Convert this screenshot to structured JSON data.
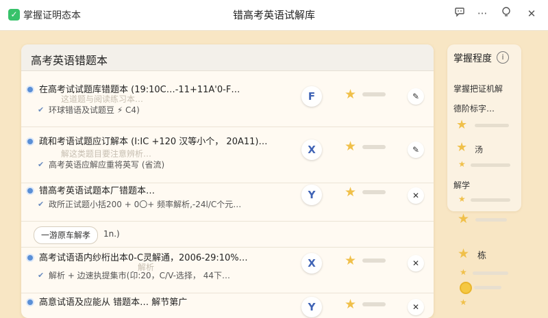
{
  "window": {
    "app_name": "掌握证明态本",
    "title": "错高考英语试解库",
    "buttons": [
      "chat-icon",
      "more-icon",
      "bulb-icon",
      "close-icon"
    ]
  },
  "panel": {
    "title": "高考英语错题本",
    "items": [
      {
        "title": "在高考试试题库错题本 (19:10C…-11+11A'0-F…",
        "ghost": "这道题与阅读练习本…",
        "subtitle": "环球错语及试题豆 ⚡ C4)",
        "action_icon": "pencil-icon"
      },
      {
        "title": "疏和考语试题应订解本 (I:IC +120 汉等小个， 20A11)…",
        "ghost": "解这类题目要注意辨析…",
        "subtitle": "高考英语应解应重将英写 (省流)",
        "action_icon": "pencil-icon"
      },
      {
        "title": "错高考英语试题本厂错题本…",
        "ghost": "",
        "subtitle": "政所正试题小括200 + 0〇+ 频率解析,-24l/C个元…",
        "action_icon": "close-icon"
      }
    ],
    "group": {
      "label": "一游原车解孝",
      "count": "1n.)"
    },
    "items2": [
      {
        "title": "高考试语语内纱桁出本0-C灵解通，2006-29:10%…",
        "ghost": "解析",
        "subtitle": "解析 + 边速执提集市(卬:20，C/V-选择， 44下…",
        "action_icon": "close-icon"
      },
      {
        "title": "高意试语及应能从 错题本… 解节第广",
        "ghost": "",
        "subtitle": "",
        "action_icon": "close-icon"
      }
    ]
  },
  "sidebar": {
    "title": "掌握程度",
    "heading": "掌握把证机解",
    "items": [
      "德阶标字…",
      "汤",
      "解学"
    ],
    "extra_label": "栋"
  },
  "colors": {
    "background": "#f8e6c4",
    "star": "#f0c04a",
    "accent": "#3f63b5"
  }
}
